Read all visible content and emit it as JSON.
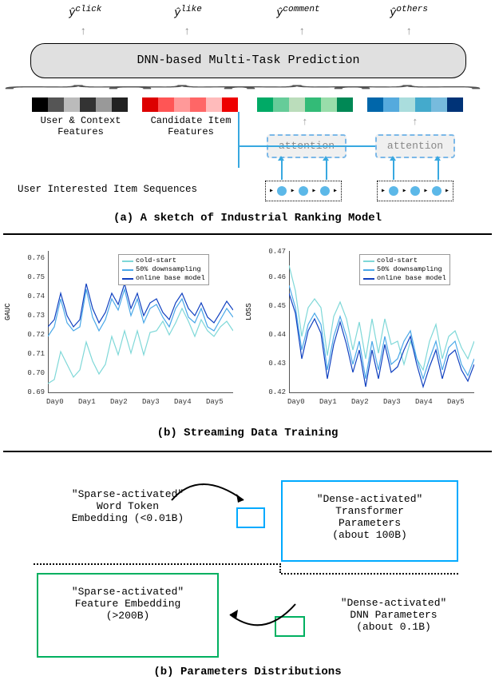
{
  "figure_a": {
    "outputs": [
      "ŷ^{click}",
      "ŷ^{like}",
      "ŷ^{comment}",
      "ŷ^{others}"
    ],
    "dnn_label": "DNN-based Multi-Task Prediction",
    "feature_groups": [
      {
        "label": "User & Context\nFeatures",
        "colors": [
          "#000",
          "#555",
          "#aaa",
          "#333",
          "#ccc",
          "#222"
        ]
      },
      {
        "label": "Candidate Item\nFeatures",
        "colors": [
          "#d00",
          "#f55",
          "#f99",
          "#f66",
          "#faa",
          "#e00"
        ]
      },
      {
        "label": "",
        "colors": [
          "#0a6",
          "#6c9",
          "#9da",
          "#3b7",
          "#8cb",
          "#0a6"
        ]
      },
      {
        "label": "",
        "colors": [
          "#06a",
          "#5ad",
          "#8cd",
          "#4ac",
          "#7bd",
          "#048"
        ]
      }
    ],
    "attention_label": "attention",
    "seq_label": "User Interested Item Sequences",
    "caption": "(a) A sketch of Industrial Ranking Model"
  },
  "figure_b": {
    "caption": "(b) Streaming Data Training",
    "legend": [
      "cold-start",
      "50% downsampling",
      "online base model"
    ],
    "legend_colors": [
      "#7fd8d8",
      "#4aa8e8",
      "#1040c0"
    ],
    "left": {
      "ylabel": "GAUC",
      "yticks": [
        "0.69",
        "0.70",
        "0.71",
        "0.72",
        "0.73",
        "0.74",
        "0.75",
        "0.76"
      ]
    },
    "right": {
      "ylabel": "LOSS",
      "yticks": [
        "0.42",
        "0.43",
        "0.44",
        "0.45",
        "0.46",
        "0.47"
      ]
    },
    "xticks": [
      "Day0",
      "Day1",
      "Day2",
      "Day3",
      "Day4",
      "Day5"
    ]
  },
  "figure_c": {
    "sparse_word": "\"Sparse-activated\"\nWord Token\nEmbedding (<0.01B)",
    "dense_trans": "\"Dense-activated\"\nTransformer\nParameters\n(about 100B)",
    "sparse_feat": "\"Sparse-activated\"\nFeature Embedding\n(>200B)",
    "dense_dnn": "\"Dense-activated\"\nDNN Parameters\n(about 0.1B)",
    "caption": "(b) Parameters Distributions"
  },
  "chart_data": [
    {
      "type": "line",
      "title": "",
      "xlabel": "",
      "ylabel": "GAUC",
      "ylim": [
        0.685,
        0.76
      ],
      "categories": [
        "Day0",
        "Day1",
        "Day2",
        "Day3",
        "Day4",
        "Day5"
      ],
      "series": [
        {
          "name": "cold-start",
          "color": "#7fd8d8",
          "values": [
            0.69,
            0.692,
            0.707,
            0.7,
            0.693,
            0.697,
            0.712,
            0.702,
            0.695,
            0.7,
            0.715,
            0.705,
            0.718,
            0.706,
            0.718,
            0.705,
            0.717,
            0.718,
            0.723,
            0.716,
            0.722,
            0.73,
            0.723,
            0.715,
            0.724,
            0.718,
            0.715,
            0.72,
            0.723,
            0.718
          ]
        },
        {
          "name": "50% downsampling",
          "color": "#4aa8e8",
          "values": [
            0.715,
            0.72,
            0.735,
            0.722,
            0.718,
            0.72,
            0.74,
            0.725,
            0.718,
            0.724,
            0.735,
            0.729,
            0.74,
            0.726,
            0.735,
            0.722,
            0.73,
            0.732,
            0.725,
            0.72,
            0.73,
            0.735,
            0.725,
            0.722,
            0.73,
            0.72,
            0.718,
            0.724,
            0.73,
            0.725
          ]
        },
        {
          "name": "online base model",
          "color": "#1040c0",
          "values": [
            0.72,
            0.724,
            0.738,
            0.726,
            0.72,
            0.724,
            0.743,
            0.73,
            0.722,
            0.728,
            0.738,
            0.732,
            0.743,
            0.73,
            0.738,
            0.726,
            0.733,
            0.735,
            0.728,
            0.724,
            0.733,
            0.738,
            0.73,
            0.726,
            0.733,
            0.725,
            0.722,
            0.728,
            0.734,
            0.729
          ]
        }
      ]
    },
    {
      "type": "line",
      "title": "",
      "xlabel": "",
      "ylabel": "LOSS",
      "ylim": [
        0.42,
        0.47
      ],
      "categories": [
        "Day0",
        "Day1",
        "Day2",
        "Day3",
        "Day4",
        "Day5"
      ],
      "series": [
        {
          "name": "cold-start",
          "color": "#7fd8d8",
          "values": [
            0.465,
            0.456,
            0.44,
            0.45,
            0.453,
            0.45,
            0.433,
            0.447,
            0.452,
            0.446,
            0.435,
            0.445,
            0.432,
            0.446,
            0.434,
            0.446,
            0.437,
            0.438,
            0.43,
            0.438,
            0.432,
            0.428,
            0.438,
            0.444,
            0.432,
            0.44,
            0.442,
            0.436,
            0.432,
            0.438
          ]
        },
        {
          "name": "50% downsampling",
          "color": "#4aa8e8",
          "values": [
            0.458,
            0.45,
            0.435,
            0.444,
            0.448,
            0.444,
            0.428,
            0.44,
            0.447,
            0.44,
            0.43,
            0.438,
            0.425,
            0.438,
            0.428,
            0.44,
            0.43,
            0.432,
            0.438,
            0.442,
            0.432,
            0.425,
            0.432,
            0.438,
            0.428,
            0.436,
            0.438,
            0.43,
            0.426,
            0.432
          ]
        },
        {
          "name": "online base model",
          "color": "#1040c0",
          "values": [
            0.455,
            0.448,
            0.432,
            0.442,
            0.446,
            0.441,
            0.425,
            0.437,
            0.445,
            0.437,
            0.427,
            0.435,
            0.422,
            0.435,
            0.425,
            0.437,
            0.427,
            0.429,
            0.435,
            0.44,
            0.43,
            0.422,
            0.429,
            0.435,
            0.425,
            0.433,
            0.435,
            0.428,
            0.424,
            0.43
          ]
        }
      ]
    }
  ]
}
